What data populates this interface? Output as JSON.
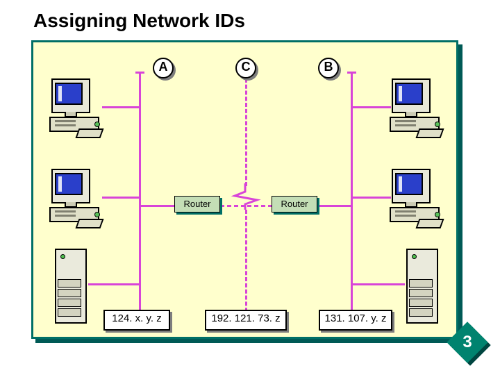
{
  "title": "Assigning Network IDs",
  "segments": {
    "A": {
      "label": "A",
      "ip": "124. x. y. z"
    },
    "C": {
      "label": "C",
      "ip": "192. 121. 73. z"
    },
    "B": {
      "label": "B",
      "ip": "131. 107. y. z"
    }
  },
  "router_label": "Router",
  "slide_number": "3"
}
